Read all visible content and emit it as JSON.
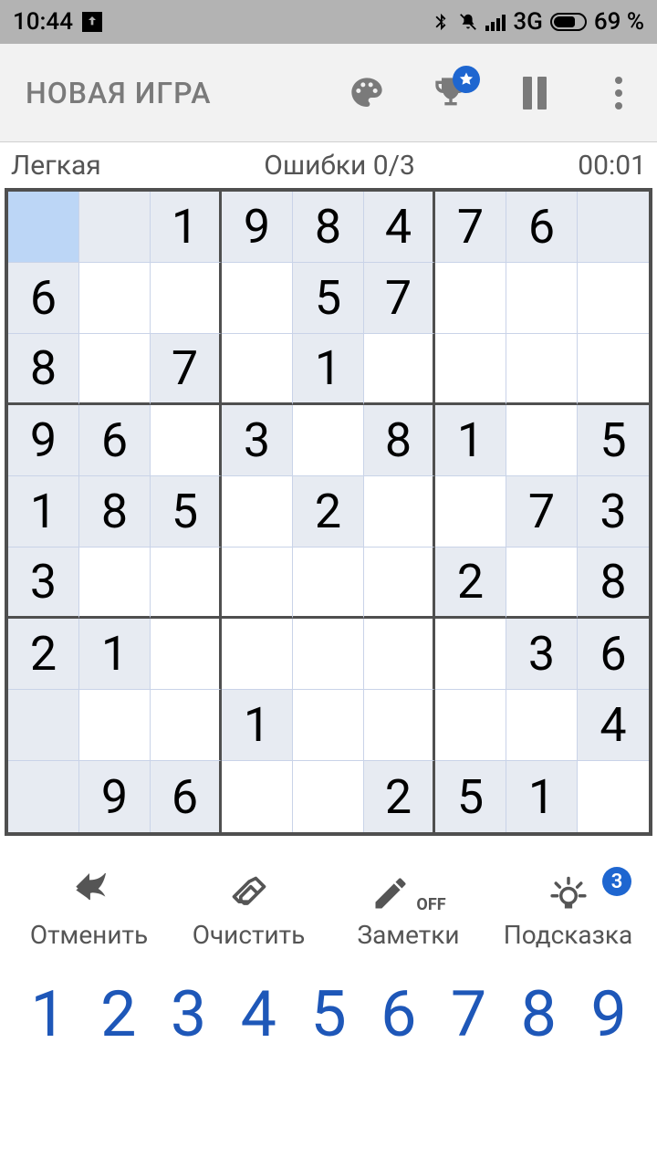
{
  "status": {
    "time": "10:44",
    "network": "3G",
    "battery_pct": "69 %"
  },
  "appbar": {
    "title": "НОВАЯ ИГРА"
  },
  "info": {
    "difficulty": "Легкая",
    "mistakes": "Ошибки 0/3",
    "timer": "00:01"
  },
  "board": {
    "selected": [
      0,
      0
    ],
    "rows": [
      [
        {
          "v": "",
          "g": true
        },
        {
          "v": "",
          "g": true
        },
        {
          "v": "1",
          "g": true
        },
        {
          "v": "9",
          "g": true
        },
        {
          "v": "8",
          "g": true
        },
        {
          "v": "4",
          "g": true
        },
        {
          "v": "7",
          "g": true
        },
        {
          "v": "6",
          "g": true
        },
        {
          "v": "",
          "g": true
        }
      ],
      [
        {
          "v": "6",
          "g": true
        },
        {
          "v": "",
          "g": false
        },
        {
          "v": "",
          "g": false
        },
        {
          "v": "",
          "g": false
        },
        {
          "v": "5",
          "g": true
        },
        {
          "v": "7",
          "g": true
        },
        {
          "v": "",
          "g": false
        },
        {
          "v": "",
          "g": false
        },
        {
          "v": "",
          "g": false
        }
      ],
      [
        {
          "v": "8",
          "g": true
        },
        {
          "v": "",
          "g": false
        },
        {
          "v": "7",
          "g": true
        },
        {
          "v": "",
          "g": false
        },
        {
          "v": "1",
          "g": true
        },
        {
          "v": "",
          "g": false
        },
        {
          "v": "",
          "g": false
        },
        {
          "v": "",
          "g": false
        },
        {
          "v": "",
          "g": false
        }
      ],
      [
        {
          "v": "9",
          "g": true
        },
        {
          "v": "6",
          "g": true
        },
        {
          "v": "",
          "g": false
        },
        {
          "v": "3",
          "g": true
        },
        {
          "v": "",
          "g": false
        },
        {
          "v": "8",
          "g": true
        },
        {
          "v": "1",
          "g": true
        },
        {
          "v": "",
          "g": false
        },
        {
          "v": "5",
          "g": true
        }
      ],
      [
        {
          "v": "1",
          "g": true
        },
        {
          "v": "8",
          "g": true
        },
        {
          "v": "5",
          "g": true
        },
        {
          "v": "",
          "g": false
        },
        {
          "v": "2",
          "g": true
        },
        {
          "v": "",
          "g": false
        },
        {
          "v": "",
          "g": false
        },
        {
          "v": "7",
          "g": true
        },
        {
          "v": "3",
          "g": true
        }
      ],
      [
        {
          "v": "3",
          "g": true
        },
        {
          "v": "",
          "g": false
        },
        {
          "v": "",
          "g": false
        },
        {
          "v": "",
          "g": false
        },
        {
          "v": "",
          "g": false
        },
        {
          "v": "",
          "g": false
        },
        {
          "v": "2",
          "g": true
        },
        {
          "v": "",
          "g": false
        },
        {
          "v": "8",
          "g": true
        }
      ],
      [
        {
          "v": "2",
          "g": true
        },
        {
          "v": "1",
          "g": true
        },
        {
          "v": "",
          "g": false
        },
        {
          "v": "",
          "g": false
        },
        {
          "v": "",
          "g": false
        },
        {
          "v": "",
          "g": false
        },
        {
          "v": "",
          "g": false
        },
        {
          "v": "3",
          "g": true
        },
        {
          "v": "6",
          "g": true
        }
      ],
      [
        {
          "v": "",
          "g": true
        },
        {
          "v": "",
          "g": false
        },
        {
          "v": "",
          "g": false
        },
        {
          "v": "1",
          "g": true
        },
        {
          "v": "",
          "g": false
        },
        {
          "v": "",
          "g": false
        },
        {
          "v": "",
          "g": false
        },
        {
          "v": "",
          "g": false
        },
        {
          "v": "4",
          "g": true
        }
      ],
      [
        {
          "v": "",
          "g": true
        },
        {
          "v": "9",
          "g": true
        },
        {
          "v": "6",
          "g": true
        },
        {
          "v": "",
          "g": false
        },
        {
          "v": "",
          "g": false
        },
        {
          "v": "2",
          "g": true
        },
        {
          "v": "5",
          "g": true
        },
        {
          "v": "1",
          "g": true
        },
        {
          "v": "",
          "g": false
        }
      ]
    ]
  },
  "controls": {
    "undo": "Отменить",
    "erase": "Очистить",
    "notes": "Заметки",
    "notes_state": "OFF",
    "hint": "Подсказка",
    "hint_count": "3"
  },
  "numpad": [
    "1",
    "2",
    "3",
    "4",
    "5",
    "6",
    "7",
    "8",
    "9"
  ]
}
